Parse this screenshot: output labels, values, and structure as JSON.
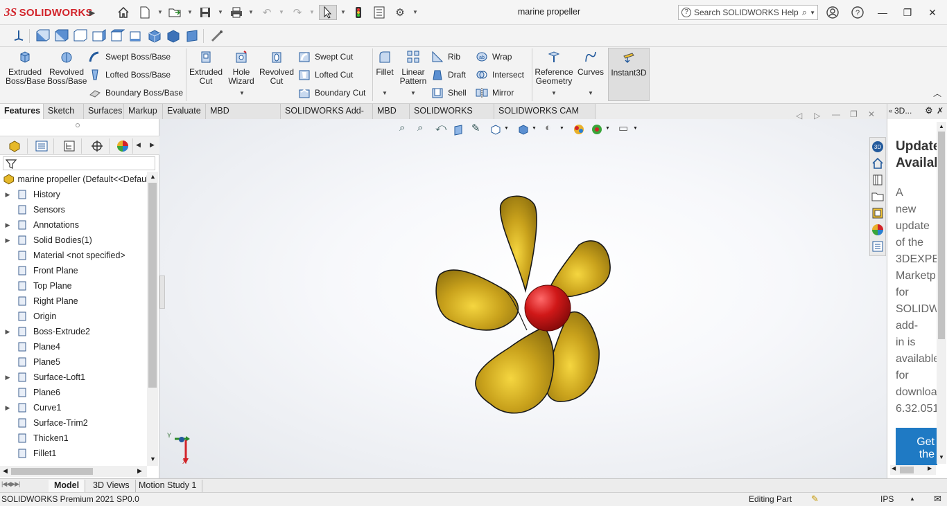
{
  "app": {
    "brand": "SOLIDWORKS",
    "brand_prefix": "3S",
    "document_title": "marine propeller"
  },
  "search": {
    "placeholder": "Search SOLIDWORKS Help"
  },
  "ribbon": {
    "extruded_boss": "Extruded Boss/Base",
    "revolved_boss": "Revolved Boss/Base",
    "swept_boss": "Swept Boss/Base",
    "lofted_boss": "Lofted Boss/Base",
    "boundary_boss": "Boundary Boss/Base",
    "extruded_cut": "Extruded Cut",
    "hole_wizard": "Hole Wizard",
    "revolved_cut": "Revolved Cut",
    "swept_cut": "Swept Cut",
    "lofted_cut": "Lofted Cut",
    "boundary_cut": "Boundary Cut",
    "fillet": "Fillet",
    "linear_pattern": "Linear Pattern",
    "rib": "Rib",
    "draft": "Draft",
    "shell": "Shell",
    "wrap": "Wrap",
    "intersect": "Intersect",
    "mirror": "Mirror",
    "reference_geometry": "Reference Geometry",
    "curves": "Curves",
    "instant3d": "Instant3D"
  },
  "tabs": [
    "Features",
    "Sketch",
    "Surfaces",
    "Markup",
    "Evaluate",
    "MBD Dimensions",
    "SOLIDWORKS Add-Ins",
    "MBD",
    "SOLIDWORKS CAM",
    "SOLIDWORKS CAM TBM"
  ],
  "tree": {
    "root": "marine propeller  (Default<<Default",
    "items": [
      {
        "label": "History",
        "expandable": true
      },
      {
        "label": "Sensors",
        "expandable": false
      },
      {
        "label": "Annotations",
        "expandable": true
      },
      {
        "label": "Solid Bodies(1)",
        "expandable": true
      },
      {
        "label": "Material <not specified>",
        "expandable": false
      },
      {
        "label": "Front Plane",
        "expandable": false
      },
      {
        "label": "Top Plane",
        "expandable": false
      },
      {
        "label": "Right Plane",
        "expandable": false
      },
      {
        "label": "Origin",
        "expandable": false
      },
      {
        "label": "Boss-Extrude2",
        "expandable": true
      },
      {
        "label": "Plane4",
        "expandable": false
      },
      {
        "label": "Plane5",
        "expandable": false
      },
      {
        "label": "Surface-Loft1",
        "expandable": true
      },
      {
        "label": "Plane6",
        "expandable": false
      },
      {
        "label": "Curve1",
        "expandable": true
      },
      {
        "label": "Surface-Trim2",
        "expandable": false
      },
      {
        "label": "Thicken1",
        "expandable": false
      },
      {
        "label": "Fillet1",
        "expandable": false
      }
    ]
  },
  "triad": {
    "y_label": "Y",
    "x_label": "X"
  },
  "right_panel": {
    "header": "3D...",
    "title_lines": [
      "Update",
      "Availab"
    ],
    "body_lines": [
      "A",
      "new",
      "update",
      "of the",
      "3DEXPE",
      "Marketp",
      "for",
      "SOLIDW",
      "add-",
      "in is",
      "available",
      "for",
      "downloa",
      "6.32.051"
    ],
    "button_lines": [
      "Get",
      "the"
    ]
  },
  "bottom_tabs": [
    "Model",
    "3D Views",
    "Motion Study 1"
  ],
  "status": {
    "product": "SOLIDWORKS Premium 2021 SP0.0",
    "mode": "Editing Part",
    "units": "IPS"
  },
  "colors": {
    "propeller": "#c9a21c",
    "hub": "#d01818",
    "accent": "#1f7ac4",
    "brand": "#d2232a"
  }
}
